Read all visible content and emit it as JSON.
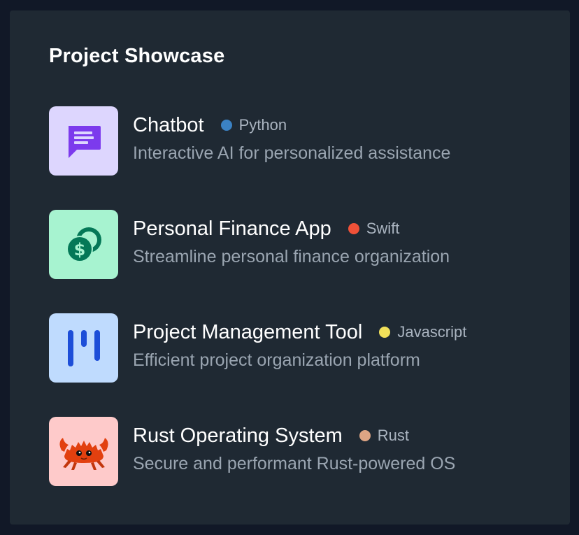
{
  "section": {
    "title": "Project Showcase"
  },
  "projects": [
    {
      "name": "Chatbot",
      "language": "Python",
      "description": "Interactive AI for personalized assistance",
      "icon": "chat-bubble-icon",
      "tile_color": "#ddd6fe",
      "icon_color": "#7c3aed",
      "dot_color": "#3b82c4"
    },
    {
      "name": "Personal Finance App",
      "language": "Swift",
      "description": "Streamline personal finance organization",
      "icon": "coins-dollar-icon",
      "tile_color": "#a7f3d0",
      "icon_color": "#047857",
      "dot_color": "#f05138"
    },
    {
      "name": "Project Management Tool",
      "language": "Javascript",
      "description": "Efficient project organization platform",
      "icon": "kanban-columns-icon",
      "tile_color": "#bfdbfe",
      "icon_color": "#1d4ed8",
      "dot_color": "#f1e05a"
    },
    {
      "name": "Rust Operating System",
      "language": "Rust",
      "description": "Secure and performant Rust-powered OS",
      "icon": "ferris-crab-icon",
      "tile_color": "#fecaca",
      "icon_color": "#e2400f",
      "dot_color": "#dea584"
    }
  ]
}
